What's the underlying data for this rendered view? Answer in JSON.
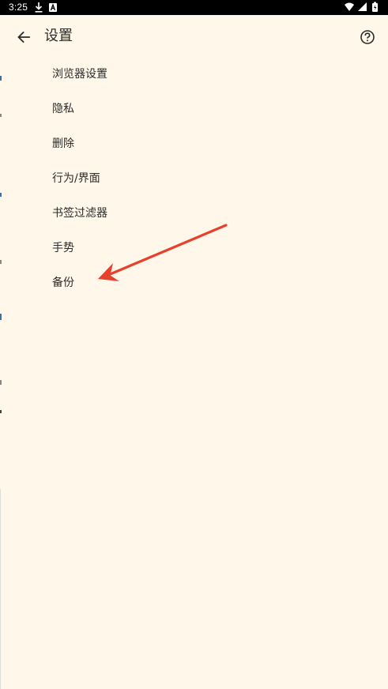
{
  "status_bar": {
    "time": "3:25",
    "icons": [
      "download-icon",
      "a-notification-icon",
      "wifi-icon",
      "signal-icon",
      "battery-icon"
    ]
  },
  "app_bar": {
    "title": "设置",
    "back_icon": "arrow-left-icon",
    "help_icon": "help-circle-icon"
  },
  "settings": {
    "items": [
      {
        "label": "浏览器设置"
      },
      {
        "label": "隐私"
      },
      {
        "label": "删除"
      },
      {
        "label": "行为/界面"
      },
      {
        "label": "书签过滤器"
      },
      {
        "label": "手势"
      },
      {
        "label": "备份"
      }
    ]
  },
  "annotation": {
    "arrow_color": "#e5412d",
    "points_to": "备份"
  },
  "colors": {
    "background": "#fff8ea",
    "text": "#2b2b2b",
    "status_bar": "#000000"
  }
}
